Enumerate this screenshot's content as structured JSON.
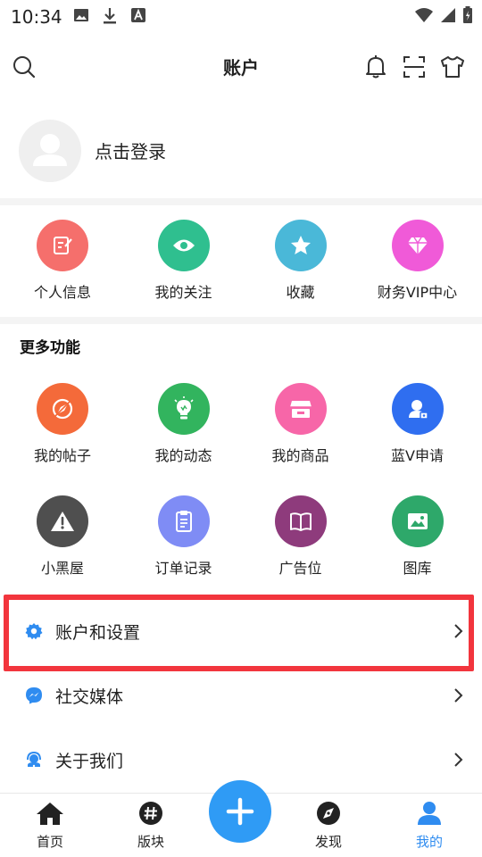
{
  "status_bar": {
    "time": "10:34",
    "icons": [
      "image-icon",
      "download-icon",
      "font-icon",
      "wifi-icon",
      "signal-icon",
      "battery-icon"
    ]
  },
  "header": {
    "title": "账户",
    "icons": [
      "search-icon",
      "bell-icon",
      "scan-icon",
      "tshirt-icon"
    ]
  },
  "profile": {
    "login_text": "点击登录"
  },
  "quick_actions": [
    {
      "label": "个人信息",
      "icon": "edit-icon",
      "color": "#f56f6c"
    },
    {
      "label": "我的关注",
      "icon": "eye-icon",
      "color": "#2fbf8f"
    },
    {
      "label": "收藏",
      "icon": "star-icon",
      "color": "#4ab8d8"
    },
    {
      "label": "财务VIP中心",
      "icon": "diamond-icon",
      "color": "#f05ad8"
    }
  ],
  "more_functions": {
    "title": "更多功能",
    "row1": [
      {
        "label": "我的帖子",
        "icon": "compass-icon",
        "color": "#f46a3a"
      },
      {
        "label": "我的动态",
        "icon": "bulb-icon",
        "color": "#32b45e"
      },
      {
        "label": "我的商品",
        "icon": "shop-icon",
        "color": "#f766a8"
      },
      {
        "label": "蓝V申请",
        "icon": "badge-user-icon",
        "color": "#2f6ef0"
      }
    ],
    "row2": [
      {
        "label": "小黑屋",
        "icon": "warning-icon",
        "color": "#4f4f4f"
      },
      {
        "label": "订单记录",
        "icon": "clipboard-icon",
        "color": "#7f8cf5"
      },
      {
        "label": "广告位",
        "icon": "book-icon",
        "color": "#8e3b7c"
      },
      {
        "label": "图库",
        "icon": "picture-icon",
        "color": "#2ea86a"
      }
    ]
  },
  "list": [
    {
      "label": "账户和设置",
      "icon": "gear-icon"
    },
    {
      "label": "社交媒体",
      "icon": "messenger-icon"
    },
    {
      "label": "关于我们",
      "icon": "support-icon"
    }
  ],
  "nav": {
    "items": [
      {
        "label": "首页",
        "icon": "home-icon"
      },
      {
        "label": "版块",
        "icon": "hashtag-icon"
      },
      {
        "label": "发现",
        "icon": "compass-nav-icon"
      },
      {
        "label": "我的",
        "icon": "user-icon"
      }
    ],
    "active_color": "#2f8cf0",
    "fab_icon": "plus-icon"
  }
}
